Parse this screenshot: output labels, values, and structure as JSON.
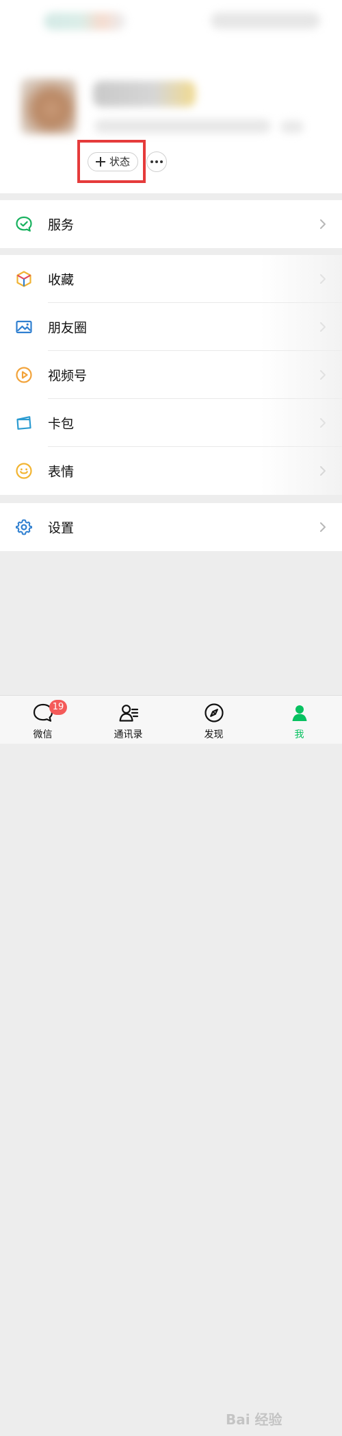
{
  "header": {
    "status_button_label": "状态"
  },
  "sections": [
    {
      "items": [
        {
          "label": "服务",
          "icon": "services-icon",
          "color": "#17b15e",
          "chevron": true
        }
      ]
    },
    {
      "items": [
        {
          "label": "收藏",
          "icon": "favorites-cube-icon",
          "color": "#f0b334",
          "chevron": true
        },
        {
          "label": "朋友圈",
          "icon": "moments-image-icon",
          "color": "#2f7fd0",
          "chevron": true
        },
        {
          "label": "视频号",
          "icon": "channels-play-icon",
          "color": "#f2a33a",
          "chevron": true
        },
        {
          "label": "卡包",
          "icon": "card-wallet-icon",
          "color": "#2b9bd1",
          "chevron": true
        },
        {
          "label": "表情",
          "icon": "sticker-face-icon",
          "color": "#f2b431",
          "chevron": true
        }
      ]
    },
    {
      "items": [
        {
          "label": "设置",
          "icon": "settings-gear-icon",
          "color": "#2f7fd0",
          "chevron": true
        }
      ]
    }
  ],
  "tabbar": {
    "items": [
      {
        "label": "微信",
        "icon": "chat-icon",
        "badge": "19",
        "active": false
      },
      {
        "label": "通讯录",
        "icon": "contacts-icon",
        "active": false
      },
      {
        "label": "发现",
        "icon": "discover-compass-icon",
        "active": false
      },
      {
        "label": "我",
        "icon": "me-icon",
        "active": true
      }
    ],
    "active_color": "#07c160"
  },
  "watermark": {
    "text": "Bai 经验"
  },
  "annotation": {
    "highlight_color": "#e53b3b"
  }
}
